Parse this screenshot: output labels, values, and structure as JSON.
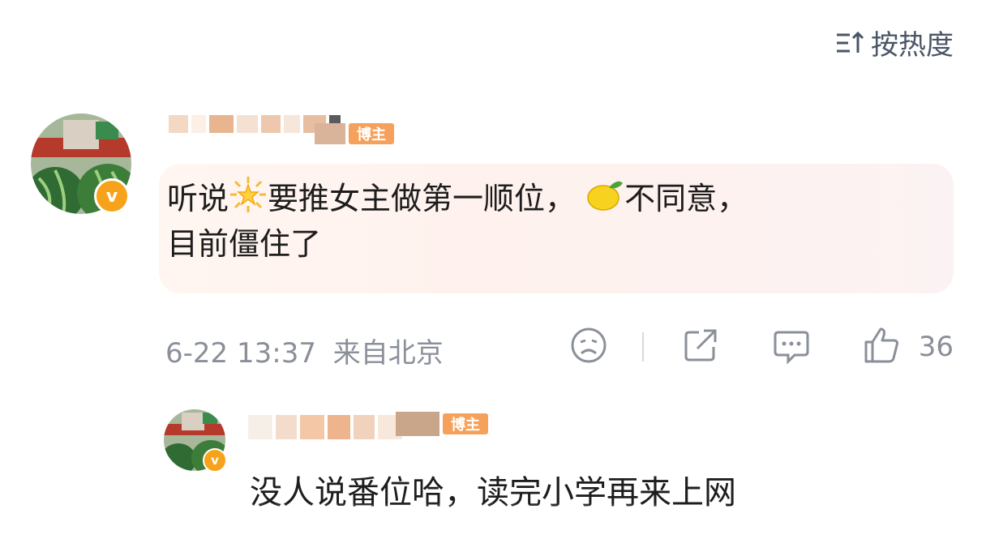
{
  "header": {
    "sort_label": "按热度",
    "sort_icon": "sort-icon"
  },
  "comment": {
    "badge": "博主",
    "text_part1": "听说",
    "emoji1": "sun-emoji",
    "text_part2": "要推女主做第一顺位，",
    "emoji2": "lemon-emoji",
    "text_part3": "不同意，",
    "text_line2": "目前僵住了",
    "time": "6-22 13:37",
    "location": "来自北京",
    "like_count": "36"
  },
  "reply": {
    "badge": "博主",
    "text": "没人说番位哈，读完小学再来上网"
  },
  "colors": {
    "accent_badge": "#f6a15b",
    "verified": "#f7a21b",
    "meta": "#8a8f99",
    "bubble": "#fff3ef"
  }
}
